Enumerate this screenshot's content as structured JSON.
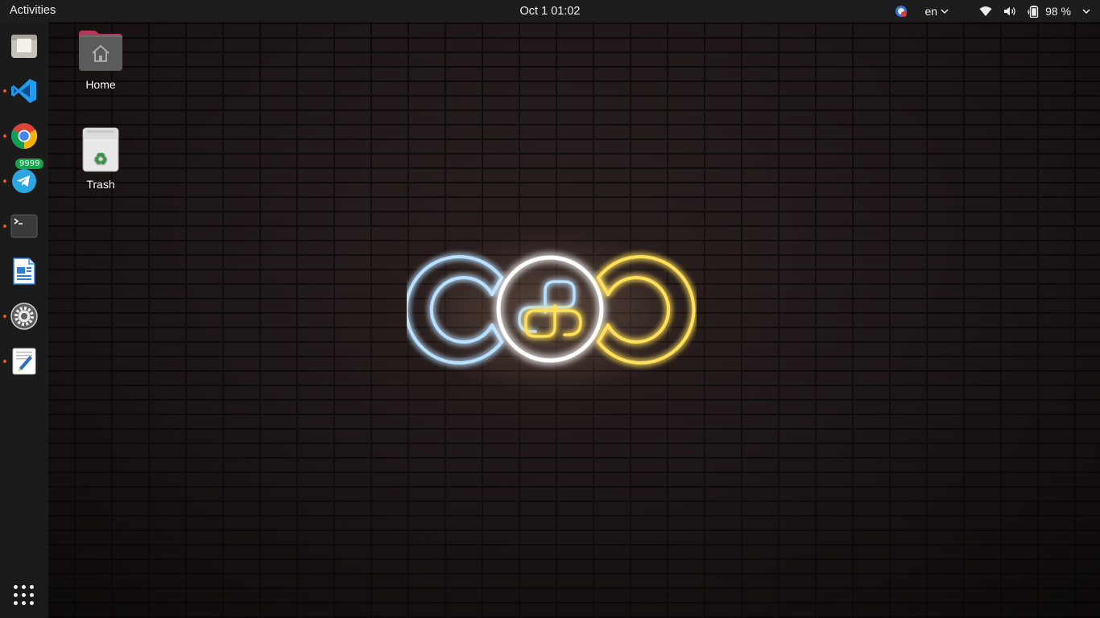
{
  "topbar": {
    "activities_label": "Activities",
    "clock": "Oct 1  01:02",
    "language": "en",
    "battery_percent": "98 %",
    "icons": [
      "notification-app-icon",
      "chevron-down-icon",
      "wifi-icon",
      "volume-icon",
      "battery-icon",
      "chevron-down-icon"
    ]
  },
  "dock": {
    "items": [
      {
        "name": "Files",
        "icon": "files-icon",
        "running": false
      },
      {
        "name": "Visual Studio Code",
        "icon": "vscode-icon",
        "running": true
      },
      {
        "name": "Google Chrome",
        "icon": "chrome-icon",
        "running": true
      },
      {
        "name": "Telegram",
        "icon": "telegram-icon",
        "running": true,
        "badge": "9999"
      },
      {
        "name": "Terminal",
        "icon": "terminal-icon",
        "running": true
      },
      {
        "name": "LibreOffice Writer",
        "icon": "writer-icon",
        "running": false
      },
      {
        "name": "Settings",
        "icon": "settings-icon",
        "running": true
      },
      {
        "name": "Text Editor",
        "icon": "text-editor-icon",
        "running": true
      }
    ],
    "show_apps_icon": "apps-grid-icon"
  },
  "desktop": {
    "icons": [
      {
        "label": "Home",
        "icon": "home-folder-icon"
      },
      {
        "label": "Trash",
        "icon": "trash-icon"
      }
    ]
  },
  "wallpaper": {
    "colors": {
      "blue": "#a9d8ff",
      "white": "#ffffff",
      "yellow": "#ffd84a"
    }
  }
}
